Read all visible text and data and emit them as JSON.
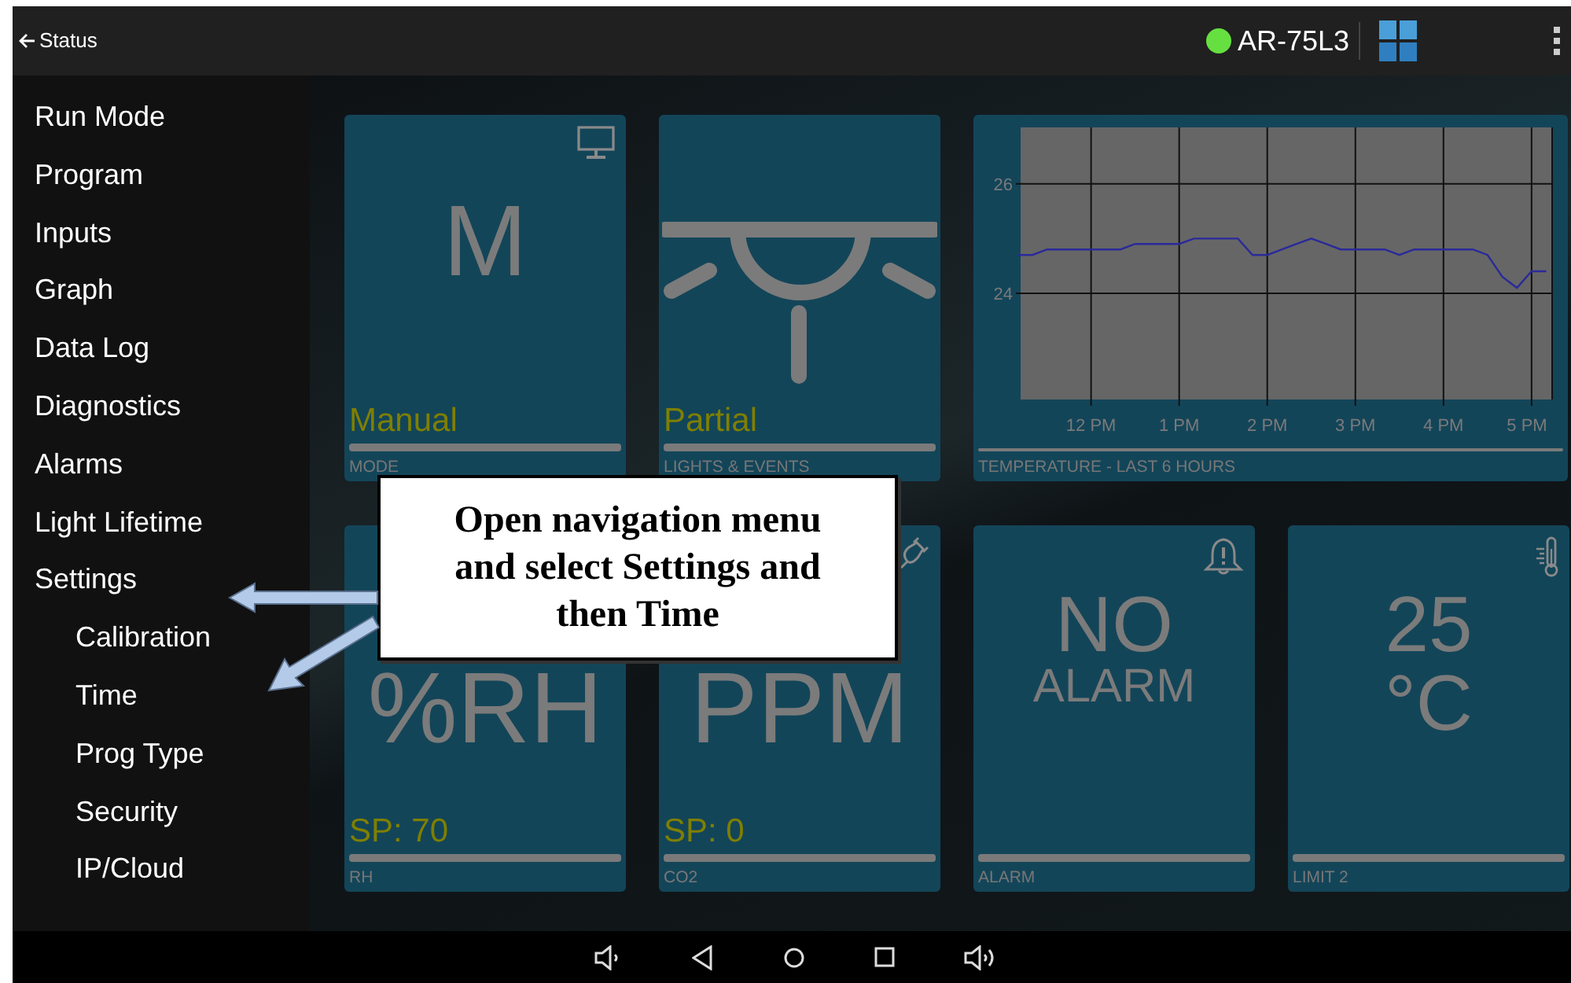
{
  "top_bar": {
    "back_label": "Status",
    "device": {
      "name": "AR-75L3",
      "online": true
    }
  },
  "menu": [
    {
      "label": "Run Mode"
    },
    {
      "label": "Program"
    },
    {
      "label": "Inputs"
    },
    {
      "label": "Graph"
    },
    {
      "label": "Data Log"
    },
    {
      "label": "Diagnostics"
    },
    {
      "label": "Alarms"
    },
    {
      "label": "Light Lifetime"
    },
    {
      "label": "Settings",
      "children": [
        {
          "label": "Calibration"
        },
        {
          "label": "Time"
        },
        {
          "label": "Prog Type"
        },
        {
          "label": "Security"
        },
        {
          "label": "IP/Cloud"
        }
      ]
    }
  ],
  "tiles": [
    [
      {
        "kind": "mode",
        "main": [
          "M"
        ],
        "value": "Manual",
        "caption": "MODE"
      },
      {
        "kind": "light",
        "value": "Partial",
        "caption": "LIGHTS & EVENTS"
      },
      {
        "kind": "chart",
        "caption": "TEMPERATURE - LAST 6 HOURS",
        "chart_data": {
          "type": "line",
          "categories": [
            null,
            null,
            null,
            null,
            null,
            "12 PM",
            null,
            null,
            null,
            null,
            null,
            "1 PM",
            null,
            null,
            null,
            null,
            null,
            "2 PM",
            null,
            null,
            null,
            null,
            null,
            "3 PM",
            null,
            null,
            null,
            null,
            null,
            "4 PM",
            null,
            null,
            null,
            null,
            null,
            "5 PM",
            null
          ],
          "series": [
            {
              "color": "#2a2a9a",
              "values": [
                24.7,
                24.7,
                24.8,
                24.8,
                24.8,
                24.8,
                24.8,
                24.8,
                24.9,
                24.9,
                24.9,
                24.9,
                25.0,
                25.0,
                25.0,
                25.0,
                24.7,
                24.7,
                24.8,
                24.9,
                25.0,
                24.9,
                24.8,
                24.8,
                24.8,
                24.8,
                24.7,
                24.8,
                24.8,
                24.8,
                24.8,
                24.8,
                24.7,
                24.3,
                24.1,
                24.4,
                24.4
              ]
            }
          ],
          "ylim": [
            22.06,
            27.03
          ],
          "grid": true,
          "yticks": [
            24,
            26
          ]
        }
      }
    ],
    [
      {
        "kind": "rh",
        "main": [
          "%RH"
        ],
        "value": "SP: 70",
        "caption": "RH"
      },
      {
        "kind": "co2",
        "main": [
          "PPM"
        ],
        "value": "SP: 0",
        "caption": "CO2"
      },
      {
        "kind": "alarm",
        "main": [
          "NO",
          "ALARM"
        ],
        "caption": "ALARM"
      },
      {
        "kind": "limit",
        "main": [
          "25",
          "°C"
        ],
        "caption": "LIMIT 2"
      }
    ]
  ],
  "callout": {
    "text": "Open navigation menu and select Settings and then Time"
  }
}
